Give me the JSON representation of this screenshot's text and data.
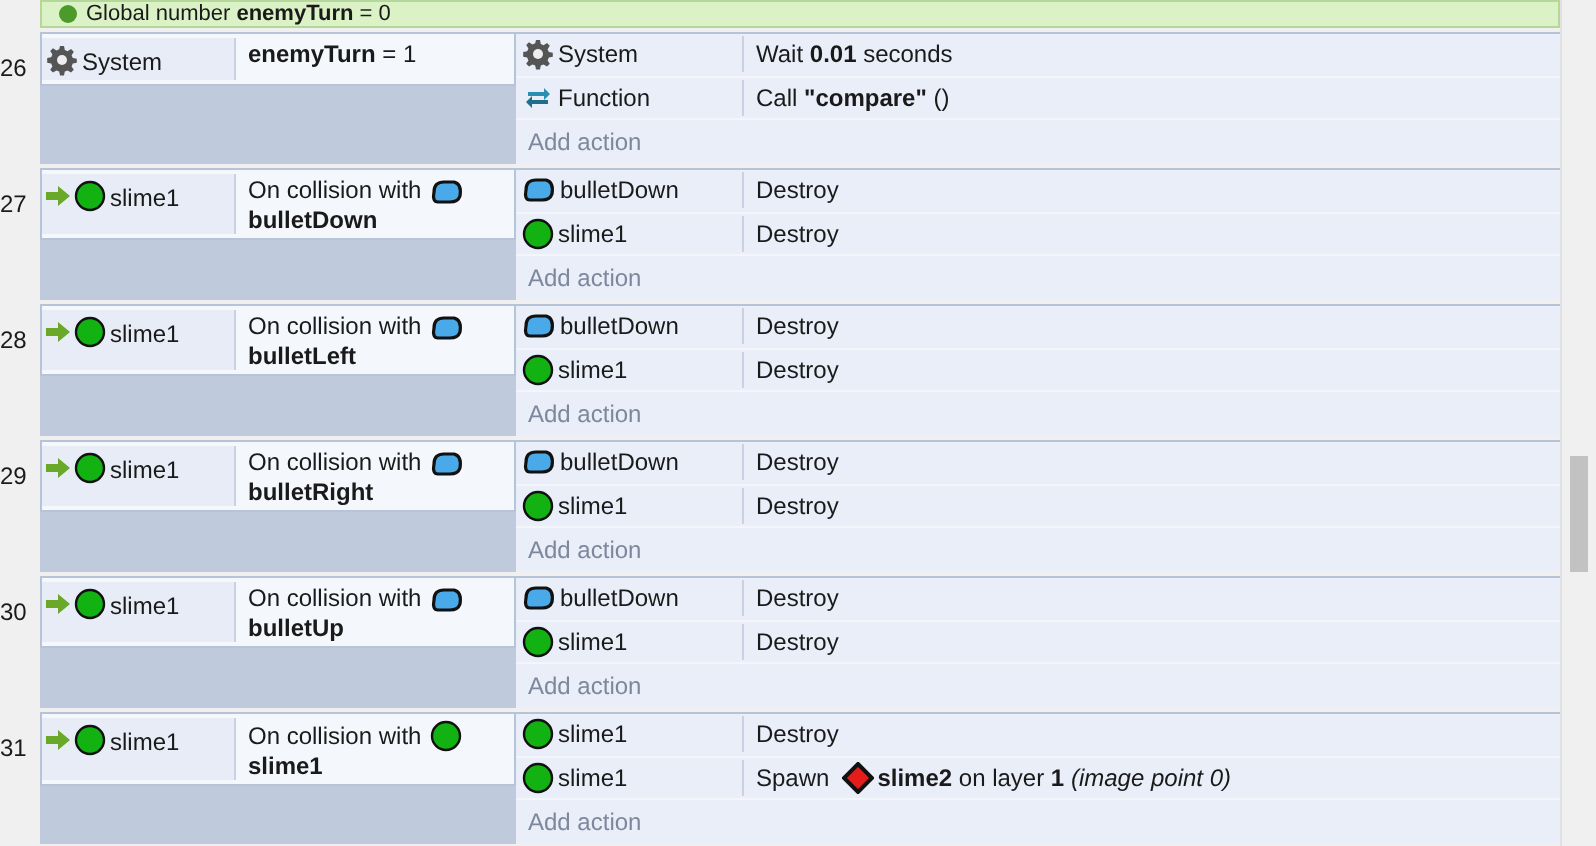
{
  "global_variable": {
    "text": "Global number **enemyTurn** = 0"
  },
  "events": [
    {
      "number": "26",
      "trigger": false,
      "conditions": [
        {
          "object": "System",
          "kind": "system",
          "text": "**enemyTurn** = 1"
        }
      ],
      "actions": [
        {
          "object": "System",
          "kind": "system",
          "text": "Wait **0.01** seconds"
        },
        {
          "object": "Function",
          "kind": "function",
          "text": "Call **\"compare\"** ()"
        }
      ],
      "add_action": "Add action"
    },
    {
      "number": "27",
      "trigger": true,
      "conditions": [
        {
          "object": "slime1",
          "kind": "slime",
          "text": "On collision with",
          "param": {
            "kind": "bullet",
            "text": "bulletDown"
          }
        }
      ],
      "actions": [
        {
          "object": "bulletDown",
          "kind": "bullet",
          "text": "Destroy"
        },
        {
          "object": "slime1",
          "kind": "slime",
          "text": "Destroy"
        }
      ],
      "add_action": "Add action"
    },
    {
      "number": "28",
      "trigger": true,
      "conditions": [
        {
          "object": "slime1",
          "kind": "slime",
          "text": "On collision with",
          "param": {
            "kind": "bullet",
            "text": "bulletLeft"
          }
        }
      ],
      "actions": [
        {
          "object": "bulletDown",
          "kind": "bullet",
          "text": "Destroy"
        },
        {
          "object": "slime1",
          "kind": "slime",
          "text": "Destroy"
        }
      ],
      "add_action": "Add action"
    },
    {
      "number": "29",
      "trigger": true,
      "conditions": [
        {
          "object": "slime1",
          "kind": "slime",
          "text": "On collision with",
          "param": {
            "kind": "bullet",
            "text": "bulletRight"
          }
        }
      ],
      "actions": [
        {
          "object": "bulletDown",
          "kind": "bullet",
          "text": "Destroy"
        },
        {
          "object": "slime1",
          "kind": "slime",
          "text": "Destroy"
        }
      ],
      "add_action": "Add action"
    },
    {
      "number": "30",
      "trigger": true,
      "conditions": [
        {
          "object": "slime1",
          "kind": "slime",
          "text": "On collision with",
          "param": {
            "kind": "bullet",
            "text": "bulletUp"
          }
        }
      ],
      "actions": [
        {
          "object": "bulletDown",
          "kind": "bullet",
          "text": "Destroy"
        },
        {
          "object": "slime1",
          "kind": "slime",
          "text": "Destroy"
        }
      ],
      "add_action": "Add action"
    },
    {
      "number": "31",
      "trigger": true,
      "conditions": [
        {
          "object": "slime1",
          "kind": "slime",
          "text": "On collision with",
          "param": {
            "kind": "slime",
            "text": "slime1"
          }
        }
      ],
      "actions": [
        {
          "object": "slime1",
          "kind": "slime",
          "text": "Destroy"
        },
        {
          "object": "slime1",
          "kind": "slime",
          "text": "Spawn",
          "param": {
            "kind": "diamond",
            "text": "**slime2** on layer **1** *(image point 0)*"
          }
        }
      ],
      "add_action": "Add action"
    }
  ]
}
